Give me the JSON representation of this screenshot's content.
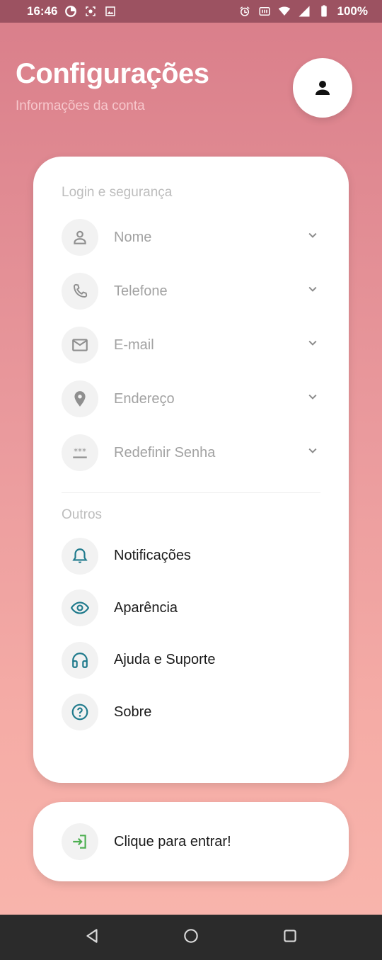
{
  "status_bar": {
    "time": "16:46",
    "battery": "100%"
  },
  "header": {
    "title": "Configurações",
    "subtitle": "Informações da conta"
  },
  "login_section": {
    "label": "Login e segurança",
    "items": [
      {
        "label": "Nome",
        "icon": "person-icon"
      },
      {
        "label": "Telefone",
        "icon": "phone-icon"
      },
      {
        "label": "E-mail",
        "icon": "mail-icon"
      },
      {
        "label": "Endereço",
        "icon": "location-icon"
      },
      {
        "label": "Redefinir Senha",
        "icon": "password-icon"
      }
    ]
  },
  "others_section": {
    "label": "Outros",
    "items": [
      {
        "label": "Notificações",
        "icon": "bell-icon"
      },
      {
        "label": "Aparência",
        "icon": "eye-icon"
      },
      {
        "label": "Ajuda e Suporte",
        "icon": "headset-icon"
      },
      {
        "label": "Sobre",
        "icon": "help-circle-icon"
      }
    ]
  },
  "login_button": {
    "label": "Clique para entrar!",
    "icon": "login-icon"
  },
  "colors": {
    "accent": "#1f7a8c",
    "login_icon": "#4caf50",
    "muted_text": "#a2a2a2"
  }
}
